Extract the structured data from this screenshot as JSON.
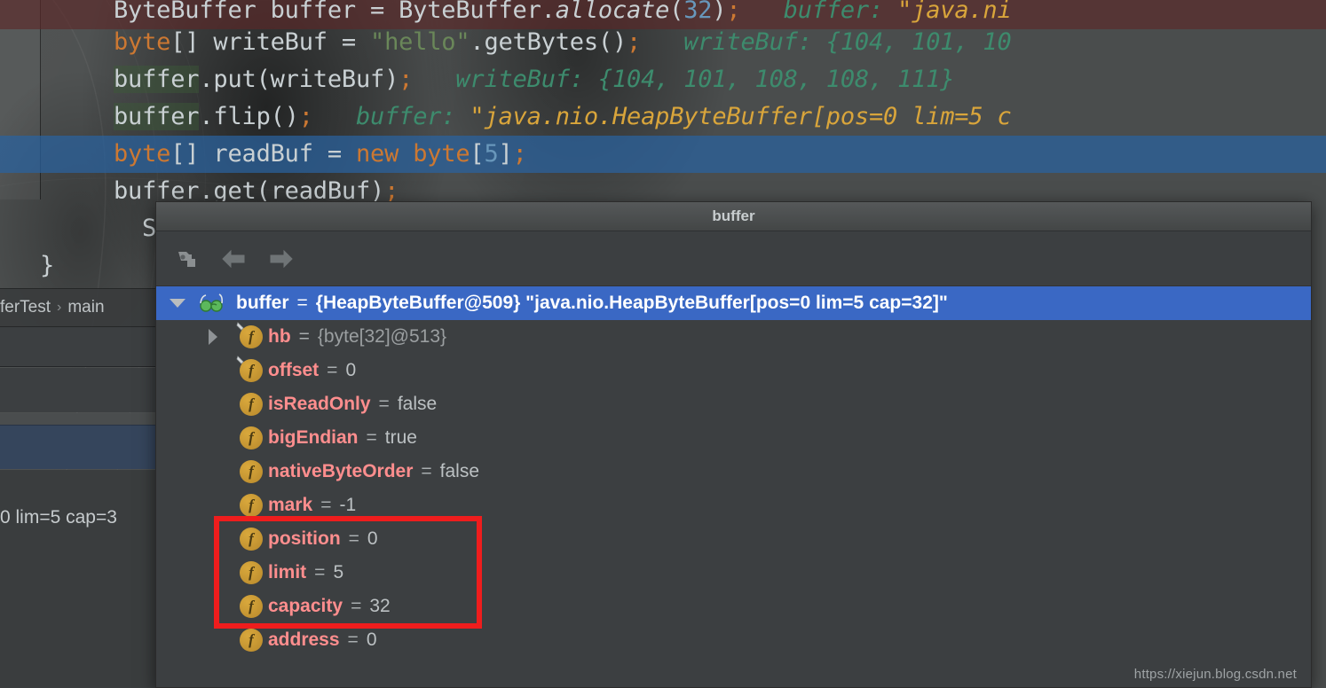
{
  "editor": {
    "gutter_icon": "breakpoint-gutter",
    "lines": [
      {
        "id": "line-allocate",
        "segments": [
          {
            "t": "ByteBuffer",
            "c": "pl"
          },
          {
            "t": " buffer = ",
            "c": "pl"
          },
          {
            "t": "ByteBuffer.",
            "c": "pl"
          },
          {
            "t": "allocate",
            "c": "pl-ital"
          },
          {
            "t": "(",
            "c": "pl"
          },
          {
            "t": "32",
            "c": "num"
          },
          {
            "t": ")",
            "c": "pl"
          },
          {
            "t": ";",
            "c": "pun"
          },
          {
            "t": "   ",
            "c": "pl"
          },
          {
            "t": "buffer:",
            "c": "hint"
          },
          {
            "t": " \"java.ni",
            "c": "hinty"
          }
        ]
      },
      {
        "id": "line-writebuf",
        "segments": [
          {
            "t": "byte",
            "c": "kw"
          },
          {
            "t": "[] writeBuf = ",
            "c": "pl"
          },
          {
            "t": "\"hello\"",
            "c": "str"
          },
          {
            "t": ".getBytes()",
            "c": "pl"
          },
          {
            "t": ";",
            "c": "pun"
          },
          {
            "t": "   ",
            "c": "pl"
          },
          {
            "t": "writeBuf:",
            "c": "hint"
          },
          {
            "t": " {104, 101, 10",
            "c": "hint"
          }
        ]
      },
      {
        "id": "line-put",
        "segments": [
          {
            "t": "buffer.put(writeBuf)",
            "c": "pl"
          },
          {
            "t": ";",
            "c": "pun"
          },
          {
            "t": "   ",
            "c": "pl"
          },
          {
            "t": "writeBuf:",
            "c": "hint"
          },
          {
            "t": " {104, 101, 108, 108, 111}",
            "c": "hint"
          }
        ]
      },
      {
        "id": "line-flip",
        "segments": [
          {
            "t": "buffer.flip()",
            "c": "pl"
          },
          {
            "t": ";",
            "c": "pun"
          },
          {
            "t": "   ",
            "c": "pl"
          },
          {
            "t": "buffer:",
            "c": "hint"
          },
          {
            "t": " \"java.nio.HeapByteBuffer[pos=0 lim=5 c",
            "c": "hinty"
          }
        ]
      },
      {
        "id": "line-readbuf",
        "segments": [
          {
            "t": "byte",
            "c": "kw"
          },
          {
            "t": "[] readBuf = ",
            "c": "pl"
          },
          {
            "t": "new ",
            "c": "kw"
          },
          {
            "t": "byte",
            "c": "kw"
          },
          {
            "t": "[",
            "c": "pl"
          },
          {
            "t": "5",
            "c": "num"
          },
          {
            "t": "]",
            "c": "pl"
          },
          {
            "t": ";",
            "c": "pun"
          }
        ]
      },
      {
        "id": "line-get",
        "segments": [
          {
            "t": "buffer.get(readBuf)",
            "c": "pl"
          },
          {
            "t": ";",
            "c": "pun"
          }
        ]
      },
      {
        "id": "line-sysout",
        "segments": [
          {
            "t": "Sy",
            "c": "pl"
          }
        ]
      },
      {
        "id": "line-closebrace",
        "segments": [
          {
            "t": "}",
            "c": "pl"
          }
        ]
      }
    ]
  },
  "breadcrumb": {
    "items": [
      "ferTest",
      "main"
    ],
    "separator": "›"
  },
  "left_fragment": {
    "text": "0 lim=5 cap=3"
  },
  "popup": {
    "title": "buffer",
    "toolbar": [
      {
        "name": "copy-value-icon",
        "label": "Copy Value"
      },
      {
        "name": "arrow-left-icon",
        "label": "Back"
      },
      {
        "name": "arrow-right-icon",
        "label": "Forward"
      }
    ],
    "tree": {
      "root": {
        "name": "buffer",
        "equals": "=",
        "value": "{HeapByteBuffer@509} \"java.nio.HeapByteBuffer[pos=0 lim=5 cap=32]\"",
        "icon": "watch-glasses-icon",
        "expander": "chevron-down-icon",
        "selected": true
      },
      "fields": [
        {
          "name": "hb",
          "equals": "=",
          "value": "{byte[32]@513}",
          "icon": "field-final-icon",
          "expandable": true,
          "value_kind": "ref",
          "highlighted": false
        },
        {
          "name": "offset",
          "equals": "=",
          "value": "0",
          "icon": "field-final-icon",
          "expandable": false,
          "value_kind": "literal",
          "highlighted": false
        },
        {
          "name": "isReadOnly",
          "equals": "=",
          "value": "false",
          "icon": "field-icon",
          "expandable": false,
          "value_kind": "literal",
          "highlighted": false
        },
        {
          "name": "bigEndian",
          "equals": "=",
          "value": "true",
          "icon": "field-icon",
          "expandable": false,
          "value_kind": "literal",
          "highlighted": false
        },
        {
          "name": "nativeByteOrder",
          "equals": "=",
          "value": "false",
          "icon": "field-icon",
          "expandable": false,
          "value_kind": "literal",
          "highlighted": false
        },
        {
          "name": "mark",
          "equals": "=",
          "value": "-1",
          "icon": "field-icon",
          "expandable": false,
          "value_kind": "literal",
          "highlighted": false
        },
        {
          "name": "position",
          "equals": "=",
          "value": "0",
          "icon": "field-icon",
          "expandable": false,
          "value_kind": "literal",
          "highlighted": true
        },
        {
          "name": "limit",
          "equals": "=",
          "value": "5",
          "icon": "field-icon",
          "expandable": false,
          "value_kind": "literal",
          "highlighted": true
        },
        {
          "name": "capacity",
          "equals": "=",
          "value": "32",
          "icon": "field-icon",
          "expandable": false,
          "value_kind": "literal",
          "highlighted": true
        },
        {
          "name": "address",
          "equals": "=",
          "value": "0",
          "icon": "field-icon",
          "expandable": false,
          "value_kind": "literal",
          "highlighted": false
        }
      ]
    }
  },
  "annotation": {
    "name": "red-highlight-box",
    "color": "#ef1d1d",
    "covers": [
      "position",
      "limit",
      "capacity"
    ]
  },
  "watermark": {
    "text": "https://xiejun.blog.csdn.net"
  },
  "colors": {
    "selection_blue": "#3a68c4",
    "field_name_red": "#ff8e8e",
    "keyword_orange": "#cc7832",
    "string_green": "#6a8759",
    "hint_teal": "#3d8b6d",
    "hint_gold": "#d9a53b",
    "popup_bg": "#3c3f41"
  }
}
